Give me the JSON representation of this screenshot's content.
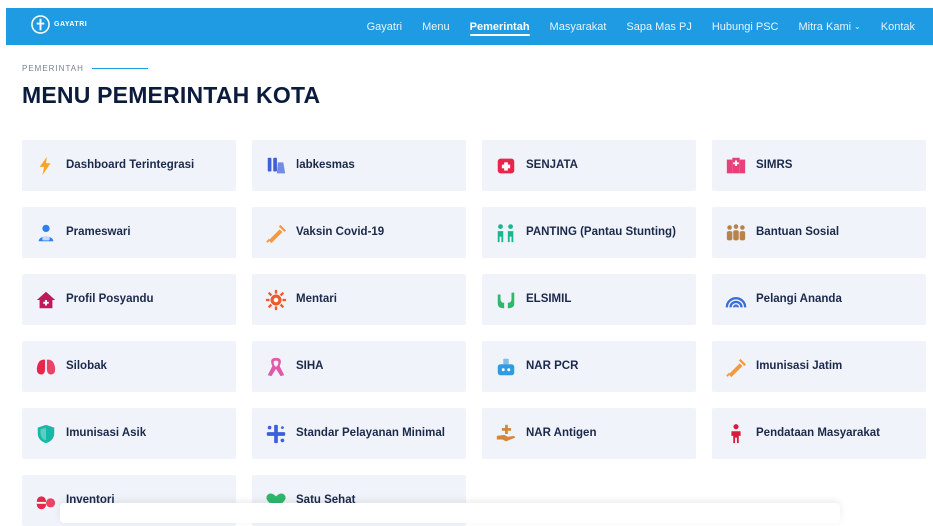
{
  "navbar": {
    "logo_text": "GAYATRI",
    "links": [
      {
        "label": "Gayatri",
        "active": false
      },
      {
        "label": "Menu",
        "active": false
      },
      {
        "label": "Pemerintah",
        "active": true
      },
      {
        "label": "Masyarakat",
        "active": false
      },
      {
        "label": "Sapa Mas PJ",
        "active": false
      },
      {
        "label": "Hubungi PSC",
        "active": false
      },
      {
        "label": "Mitra Kami",
        "active": false,
        "dropdown": true
      },
      {
        "label": "Kontak",
        "active": false
      }
    ]
  },
  "section": {
    "label": "PEMERINTAH",
    "title": "MENU PEMERINTAH KOTA"
  },
  "menu": [
    {
      "label": "Dashboard Terintegrasi",
      "icon": "lightning-icon",
      "color": "#f5a623"
    },
    {
      "label": "labkesmas",
      "icon": "lab-flask-icon",
      "color": "#3d5fd9"
    },
    {
      "label": "SENJATA",
      "icon": "medical-kit-icon",
      "color": "#e8254a"
    },
    {
      "label": "SIMRS",
      "icon": "hospital-icon",
      "color": "#e8407a"
    },
    {
      "label": "Prameswari",
      "icon": "user-group-icon",
      "color": "#2f80ed"
    },
    {
      "label": "Vaksin Covid-19",
      "icon": "syringe-icon",
      "color": "#f59a3c"
    },
    {
      "label": "PANTING (Pantau Stunting)",
      "icon": "family-icon",
      "color": "#17b890"
    },
    {
      "label": "Bantuan Sosial",
      "icon": "people-icon",
      "color": "#b8824a"
    },
    {
      "label": "Profil Posyandu",
      "icon": "house-medical-icon",
      "color": "#c2185b"
    },
    {
      "label": "Mentari",
      "icon": "sun-icon",
      "color": "#f05a28"
    },
    {
      "label": "ELSIMIL",
      "icon": "hands-icon",
      "color": "#2eb86b"
    },
    {
      "label": "Pelangi Ananda",
      "icon": "rainbow-icon",
      "color": "#3a6fd8"
    },
    {
      "label": "Silobak",
      "icon": "lungs-icon",
      "color": "#e8254a"
    },
    {
      "label": "SIHA",
      "icon": "ribbon-icon",
      "color": "#e05aa8"
    },
    {
      "label": "NAR PCR",
      "icon": "test-tube-icon",
      "color": "#2f9be3"
    },
    {
      "label": "Imunisasi Jatim",
      "icon": "syringe-icon",
      "color": "#f59a3c"
    },
    {
      "label": "Imunisasi Asik",
      "icon": "shield-icon",
      "color": "#17b8a6"
    },
    {
      "label": "Standar Pelayanan Minimal",
      "icon": "sparkle-cross-icon",
      "color": "#3d5fd9"
    },
    {
      "label": "NAR Antigen",
      "icon": "hand-medical-icon",
      "color": "#d4873a"
    },
    {
      "label": "Pendataan Masyarakat",
      "icon": "person-icon",
      "color": "#d81b3c"
    },
    {
      "label": "Inventori",
      "icon": "pills-icon",
      "color": "#e8254a"
    },
    {
      "label": "Satu Sehat",
      "icon": "heart-icon",
      "color": "#2eb86b"
    }
  ]
}
